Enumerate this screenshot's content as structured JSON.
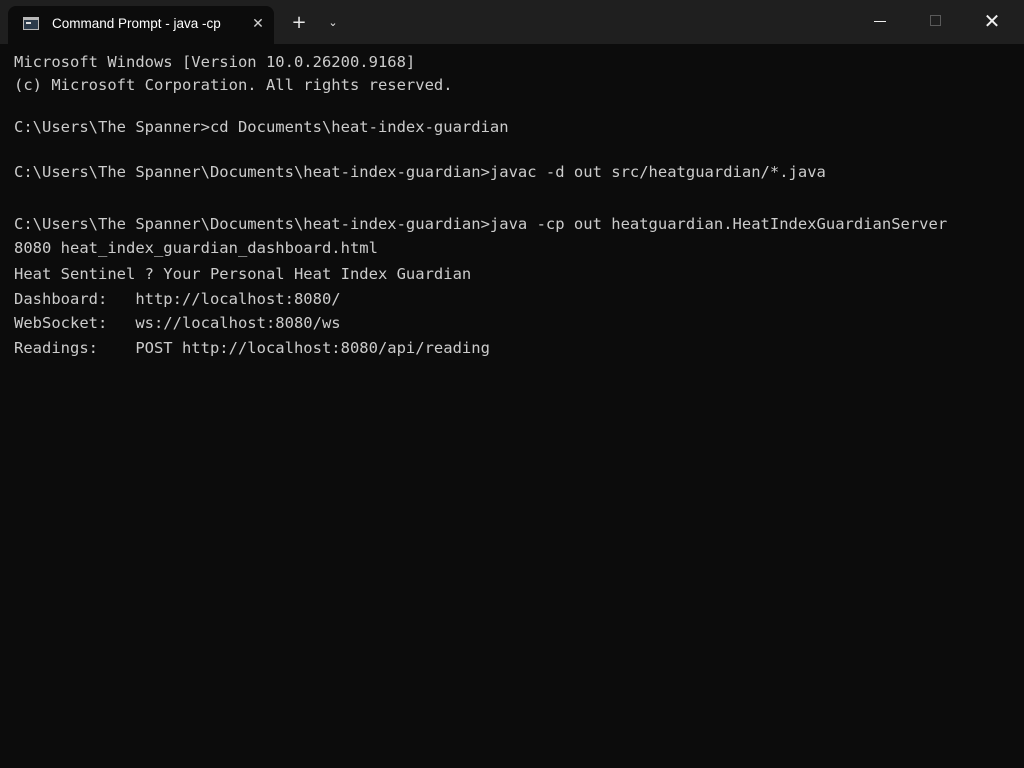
{
  "tab": {
    "title": "Command Prompt - java  -cp",
    "icon": "terminal-icon",
    "close_glyph": "✕"
  },
  "titlebar": {
    "new_tab_glyph": "+",
    "dropdown_glyph": "⌄",
    "close_glyph": "✕"
  },
  "colors": {
    "background": "#0c0c0c",
    "titlebar": "#1f1f1f",
    "text": "#cccccc"
  },
  "console": {
    "lines": [
      "Microsoft Windows [Version 10.0.26200.9168]",
      "(c) Microsoft Corporation. All rights reserved.",
      "C:\\Users\\The Spanner>cd Documents\\heat-index-guardian",
      "C:\\Users\\The Spanner\\Documents\\heat-index-guardian>javac -d out src/heatguardian/*.java",
      "C:\\Users\\The Spanner\\Documents\\heat-index-guardian>java -cp out heatguardian.HeatIndexGuardianServer",
      "8080 heat_index_guardian_dashboard.html",
      "Heat Sentinel ? Your Personal Heat Index Guardian",
      "Dashboard:   http://localhost:8080/",
      "WebSocket:   ws://localhost:8080/ws",
      "Readings:    POST http://localhost:8080/api/reading"
    ]
  }
}
